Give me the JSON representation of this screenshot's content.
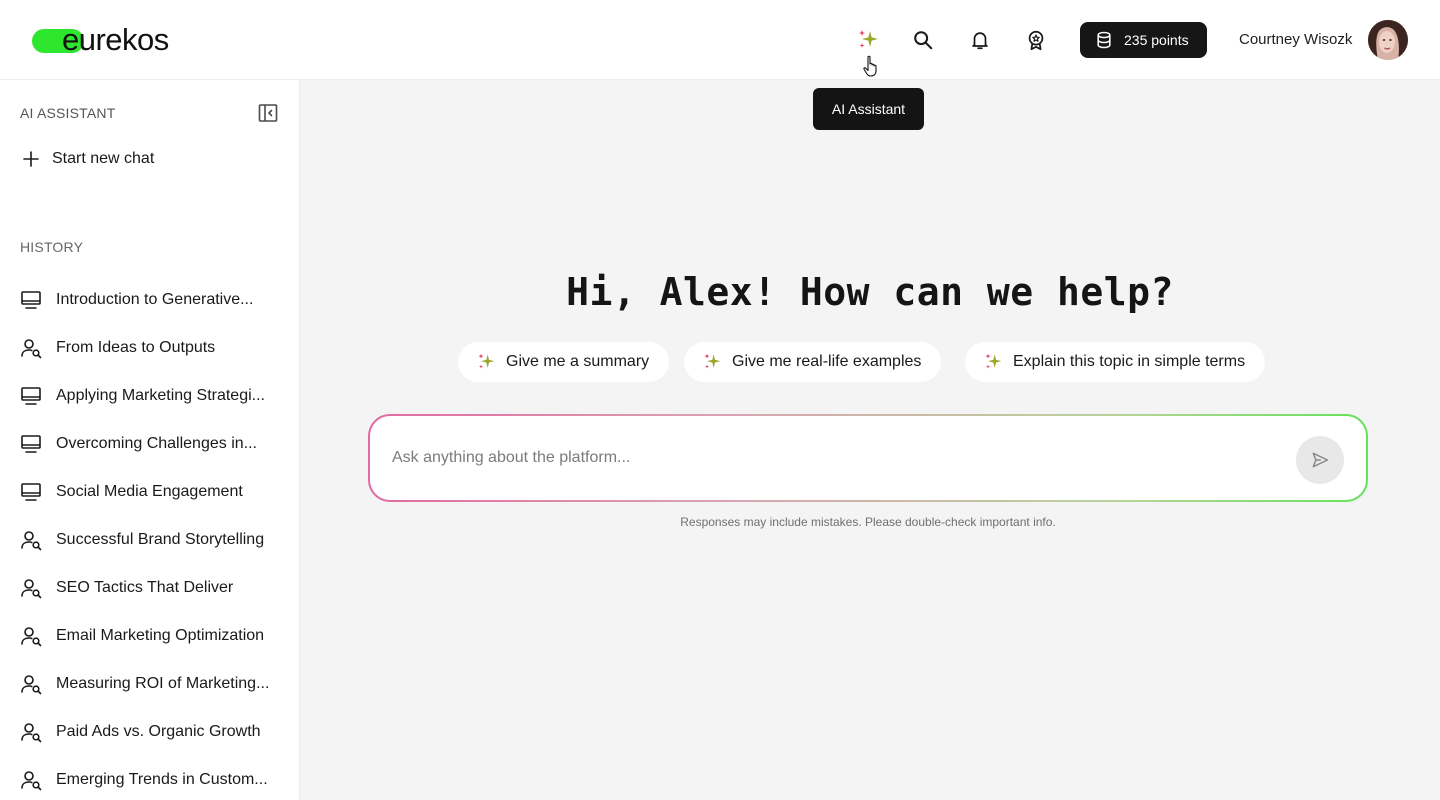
{
  "header": {
    "logo_text": "eurekos",
    "points_label": "235 points",
    "user_name": "Courtney Wisozk",
    "tooltip": "AI Assistant",
    "icons": [
      "sparkle-icon",
      "search-icon",
      "bell-icon",
      "badge-icon",
      "coins-icon"
    ]
  },
  "sidebar": {
    "title": "AI ASSISTANT",
    "new_chat_label": "Start new chat",
    "history_label": "HISTORY",
    "history": [
      {
        "label": "Introduction to Generative...",
        "icon": "monitor-icon"
      },
      {
        "label": "From Ideas to Outputs",
        "icon": "user-search-icon"
      },
      {
        "label": "Applying Marketing Strategi...",
        "icon": "monitor-icon"
      },
      {
        "label": "Overcoming Challenges in...",
        "icon": "monitor-icon"
      },
      {
        "label": "Social Media Engagement",
        "icon": "monitor-icon"
      },
      {
        "label": "Successful Brand Storytelling",
        "icon": "user-search-icon"
      },
      {
        "label": "SEO Tactics That Deliver",
        "icon": "user-search-icon"
      },
      {
        "label": "Email Marketing Optimization",
        "icon": "user-search-icon"
      },
      {
        "label": "Measuring ROI of Marketing...",
        "icon": "user-search-icon"
      },
      {
        "label": "Paid Ads vs. Organic Growth",
        "icon": "user-search-icon"
      },
      {
        "label": "Emerging Trends in Custom...",
        "icon": "user-search-icon"
      }
    ]
  },
  "main": {
    "greeting": "Hi, Alex! How can we help?",
    "suggestions": [
      {
        "label": "Give me a summary"
      },
      {
        "label": "Give me real-life examples"
      },
      {
        "label": "Explain this topic in simple terms"
      }
    ],
    "input_placeholder": "Ask anything about the platform...",
    "disclaimer": "Responses may include mistakes. Please double-check important info."
  },
  "colors": {
    "brand_green": "#2ee62e",
    "gradient_start": "#e26aa0",
    "gradient_end": "#64e25a",
    "dark": "#161616"
  }
}
